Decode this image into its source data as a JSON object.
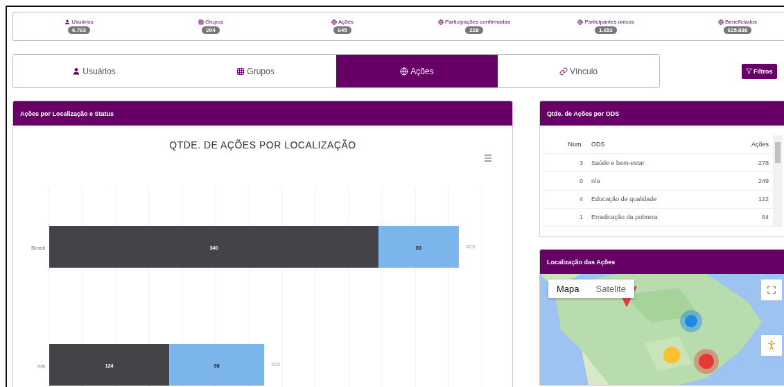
{
  "stats": [
    {
      "kind": "user",
      "label": "Usuários",
      "value": "6.763"
    },
    {
      "kind": "grid",
      "label": "Grupos",
      "value": "204"
    },
    {
      "kind": "globe",
      "label": "Ações",
      "value": "645"
    },
    {
      "kind": "globe",
      "label": "Participações confirmadas",
      "value": "228"
    },
    {
      "kind": "globe",
      "label": "Participantes únicos",
      "value": "1.652"
    },
    {
      "kind": "globe",
      "label": "Beneficiados",
      "value": "625.888"
    }
  ],
  "tabs": [
    {
      "kind": "user",
      "label": "Usuários",
      "selected": false
    },
    {
      "kind": "grid",
      "label": "Grupos",
      "selected": false
    },
    {
      "kind": "globe",
      "label": "Ações",
      "selected": true
    },
    {
      "kind": "link",
      "label": "Vínculo",
      "selected": false
    }
  ],
  "filter_button": "Filtros",
  "location_panel": {
    "title": "Ações por Localização e Status",
    "chart_data": {
      "type": "bar",
      "orientation": "horizontal",
      "stacked": true,
      "title": "QTDE. DE AÇÕES POR LOCALIZAÇÃO",
      "categories": [
        "Brasil",
        "n/a"
      ],
      "series": [
        {
          "color": "#434348",
          "values": [
            340,
            124
          ]
        },
        {
          "color": "#7cb5ec",
          "values": [
            83,
            98
          ]
        }
      ],
      "data_labels": true,
      "totals": [
        "423",
        "222"
      ]
    }
  },
  "ods_panel": {
    "title": "Qtde. de Ações por ODS",
    "columns": [
      "Num.",
      "ODS",
      "Ações"
    ],
    "rows": [
      [
        "3",
        "Saúde e bem-estar",
        "278"
      ],
      [
        "0",
        "n/a",
        "249"
      ],
      [
        "4",
        "Educação de qualidade",
        "122"
      ],
      [
        "1",
        "Erradicação da pobreza",
        "84"
      ]
    ]
  },
  "map_panel": {
    "title": "Localização das Ações",
    "map_types": [
      {
        "label": "Mapa",
        "selected": true
      },
      {
        "label": "Satelite",
        "selected": false
      }
    ]
  }
}
